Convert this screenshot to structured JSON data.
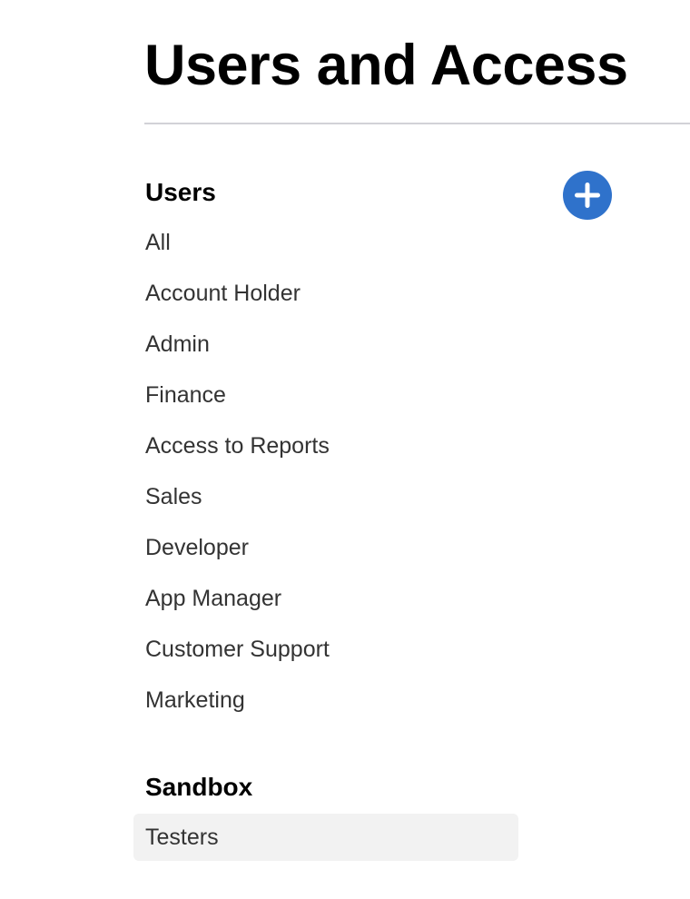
{
  "page": {
    "title": "Users and Access"
  },
  "users_section": {
    "heading": "Users",
    "add_button_icon": "plus-circle-icon",
    "add_button_color": "#2f72cb",
    "items": [
      {
        "label": "All"
      },
      {
        "label": "Account Holder"
      },
      {
        "label": "Admin"
      },
      {
        "label": "Finance"
      },
      {
        "label": "Access to Reports"
      },
      {
        "label": "Sales"
      },
      {
        "label": "Developer"
      },
      {
        "label": "App Manager"
      },
      {
        "label": "Customer Support"
      },
      {
        "label": "Marketing"
      }
    ]
  },
  "sandbox_section": {
    "heading": "Sandbox",
    "items": [
      {
        "label": "Testers",
        "selected": true
      }
    ]
  },
  "colors": {
    "accent": "#2f72cb",
    "selected_background": "#f2f2f2",
    "divider": "#d2d2d7"
  }
}
